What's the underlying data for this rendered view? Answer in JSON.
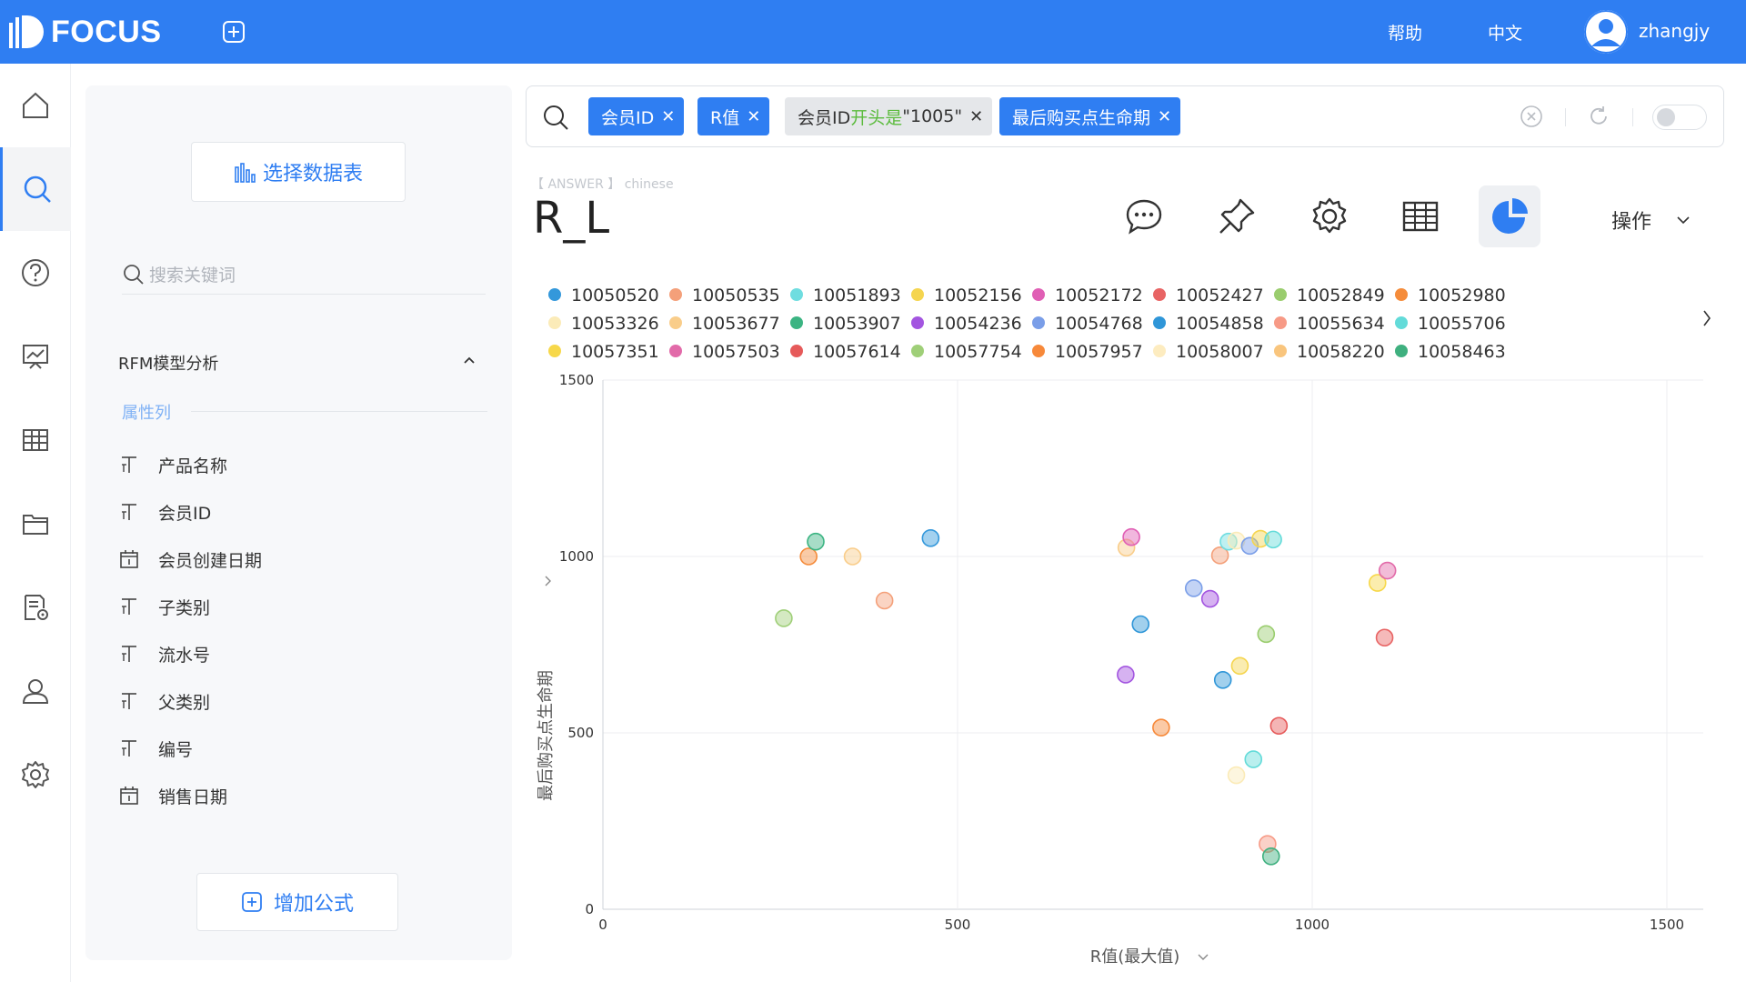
{
  "app": {
    "logo_text": "FOCUS"
  },
  "topbar": {
    "help": "帮助",
    "language": "中文",
    "username": "zhangjy"
  },
  "sidebar": {
    "select_table": "选择数据表",
    "search_placeholder": "搜索关键词",
    "group_title": "RFM模型分析",
    "section_label": "属性列",
    "fields": [
      {
        "type": "text",
        "label": "产品名称"
      },
      {
        "type": "text",
        "label": "会员ID"
      },
      {
        "type": "date",
        "label": "会员创建日期"
      },
      {
        "type": "text",
        "label": "子类别"
      },
      {
        "type": "text",
        "label": "流水号"
      },
      {
        "type": "text",
        "label": "父类别"
      },
      {
        "type": "text",
        "label": "编号"
      },
      {
        "type": "date",
        "label": "销售日期"
      }
    ],
    "add_formula": "增加公式"
  },
  "search": {
    "chips": [
      {
        "label": "会员ID",
        "style": "blue"
      },
      {
        "label": "R值",
        "style": "blue"
      },
      {
        "label_pre": "会员ID",
        "label_mid": "开头是",
        "label_post": "\"1005\"",
        "style": "gray"
      },
      {
        "label": "最后购买点生命期",
        "style": "blue"
      }
    ]
  },
  "answer": {
    "tag_left": "【 ANSWER 】",
    "tag_right": "chinese",
    "title": "R_L",
    "operations": "操作",
    "tools": [
      "chat-icon",
      "pin-icon",
      "gear-icon",
      "table-icon",
      "pie-chart-icon"
    ]
  },
  "chart_data": {
    "type": "scatter",
    "xlabel": "R值(最大值)",
    "ylabel": "最后购买点生命期",
    "xlim": [
      0,
      1500
    ],
    "ylim": [
      0,
      1500
    ],
    "xticks": [
      0,
      500,
      1000,
      1500
    ],
    "yticks": [
      0,
      500,
      1000,
      1500
    ],
    "grid": true,
    "legend_position": "top",
    "legend": [
      {
        "name": "10050520",
        "color": "#3498db"
      },
      {
        "name": "10050535",
        "color": "#f4a07a"
      },
      {
        "name": "10051893",
        "color": "#6fdde0"
      },
      {
        "name": "10052156",
        "color": "#f5d54f"
      },
      {
        "name": "10052172",
        "color": "#e05fb5"
      },
      {
        "name": "10052427",
        "color": "#e86464"
      },
      {
        "name": "10052849",
        "color": "#9acd6e"
      },
      {
        "name": "10052980",
        "color": "#f58c3b"
      },
      {
        "name": "10053326",
        "color": "#fbebb8"
      },
      {
        "name": "10053677",
        "color": "#f9cd8a"
      },
      {
        "name": "10053907",
        "color": "#3bb482"
      },
      {
        "name": "10054236",
        "color": "#a355e0"
      },
      {
        "name": "10054768",
        "color": "#7a9ee8"
      },
      {
        "name": "10054858",
        "color": "#2f96d8"
      },
      {
        "name": "10055634",
        "color": "#f79a86"
      },
      {
        "name": "10055706",
        "color": "#63dbd9"
      },
      {
        "name": "10057351",
        "color": "#f7d84a"
      },
      {
        "name": "10057503",
        "color": "#e26aa9"
      },
      {
        "name": "10057614",
        "color": "#e65a5a"
      },
      {
        "name": "10057754",
        "color": "#9fcf78"
      },
      {
        "name": "10057957",
        "color": "#f7893a"
      },
      {
        "name": "10058007",
        "color": "#fdecc0"
      },
      {
        "name": "10058220",
        "color": "#f9c57d"
      },
      {
        "name": "10058463",
        "color": "#3fb07f"
      }
    ],
    "points": [
      {
        "x": 255,
        "y": 825,
        "color": "#9fcf78"
      },
      {
        "x": 290,
        "y": 1000,
        "color": "#f58c3b"
      },
      {
        "x": 300,
        "y": 1042,
        "color": "#3bb482"
      },
      {
        "x": 352,
        "y": 1000,
        "color": "#f9cd8a"
      },
      {
        "x": 397,
        "y": 875,
        "color": "#f4a07a"
      },
      {
        "x": 462,
        "y": 1052,
        "color": "#3498db"
      },
      {
        "x": 738,
        "y": 1025,
        "color": "#f9cd8a"
      },
      {
        "x": 745,
        "y": 1055,
        "color": "#e05fb5"
      },
      {
        "x": 737,
        "y": 665,
        "color": "#a355e0"
      },
      {
        "x": 758,
        "y": 808,
        "color": "#2f96d8"
      },
      {
        "x": 787,
        "y": 515,
        "color": "#f7893a"
      },
      {
        "x": 833,
        "y": 910,
        "color": "#7a9ee8"
      },
      {
        "x": 856,
        "y": 880,
        "color": "#a355e0"
      },
      {
        "x": 870,
        "y": 1003,
        "color": "#f4a07a"
      },
      {
        "x": 874,
        "y": 650,
        "color": "#2f96d8"
      },
      {
        "x": 882,
        "y": 1042,
        "color": "#6fdde0"
      },
      {
        "x": 893,
        "y": 1045,
        "color": "#fbebb8"
      },
      {
        "x": 893,
        "y": 380,
        "color": "#fbebb8"
      },
      {
        "x": 898,
        "y": 690,
        "color": "#f5d54f"
      },
      {
        "x": 912,
        "y": 1030,
        "color": "#7a9ee8"
      },
      {
        "x": 917,
        "y": 425,
        "color": "#63dbd9"
      },
      {
        "x": 927,
        "y": 1050,
        "color": "#f5d54f"
      },
      {
        "x": 935,
        "y": 780,
        "color": "#9acd6e"
      },
      {
        "x": 937,
        "y": 185,
        "color": "#f79a86"
      },
      {
        "x": 942,
        "y": 150,
        "color": "#3fb07f"
      },
      {
        "x": 945,
        "y": 1048,
        "color": "#63dbd9"
      },
      {
        "x": 953,
        "y": 520,
        "color": "#e65a5a"
      },
      {
        "x": 1092,
        "y": 925,
        "color": "#f7d84a"
      },
      {
        "x": 1106,
        "y": 960,
        "color": "#e26aa9"
      },
      {
        "x": 1102,
        "y": 770,
        "color": "#e86464"
      }
    ]
  }
}
